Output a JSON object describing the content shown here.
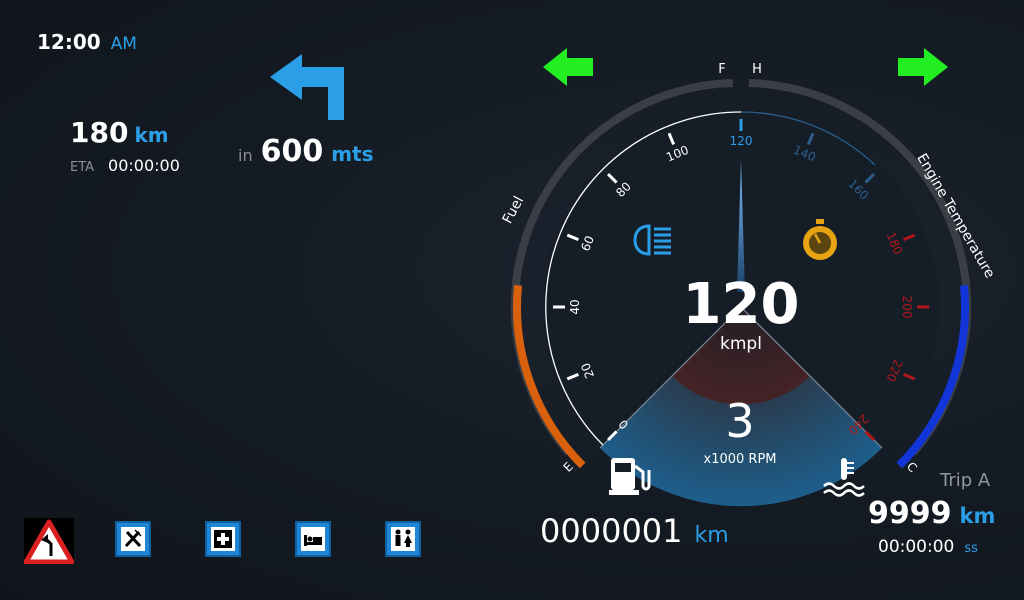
{
  "clock": {
    "time": "12:00",
    "ampm": "AM"
  },
  "trip_info": {
    "distance": "180",
    "distance_unit": "km",
    "eta_label": "ETA",
    "eta": "00:00:00"
  },
  "navigation": {
    "prefix": "in",
    "distance": "600",
    "unit": "mts",
    "maneuver_icon": "turn-left-arrow-icon"
  },
  "indicators": {
    "left": "left-turn-signal-icon",
    "right": "right-turn-signal-icon",
    "colors": {
      "turn_signal": "#22ee22"
    }
  },
  "gauge": {
    "fuel_label": "Fuel",
    "engine_temp_label": "Engine Temperature",
    "fuel_full": "F",
    "fuel_empty": "E",
    "temp_hot": "H",
    "temp_cold": "C",
    "speed_ticks": [
      "0",
      "20",
      "40",
      "60",
      "80",
      "100",
      "120",
      "140",
      "160",
      "180",
      "200",
      "220",
      "240"
    ],
    "fuel_level": 0.38,
    "temp_level": 0.38,
    "needle_value": 120,
    "colors": {
      "fuel": "#d9600c",
      "temperature": "#1235d8",
      "accent": "#2a9fe8",
      "redline": "#b01818",
      "warning": "#e7a312"
    }
  },
  "readouts": {
    "speed": "120",
    "speed_unit": "kmpl",
    "rpm": "3",
    "rpm_unit": "x1000 RPM"
  },
  "odometer": {
    "value": "0000001",
    "unit": "km"
  },
  "trip_a": {
    "label": "Trip A",
    "distance": "9999",
    "distance_unit": "km",
    "time": "00:00:00",
    "time_unit": "ss"
  },
  "poi_icons": [
    "curve-warning-sign-icon",
    "restaurant-icon",
    "hospital-icon",
    "hotel-icon",
    "restroom-icon"
  ]
}
